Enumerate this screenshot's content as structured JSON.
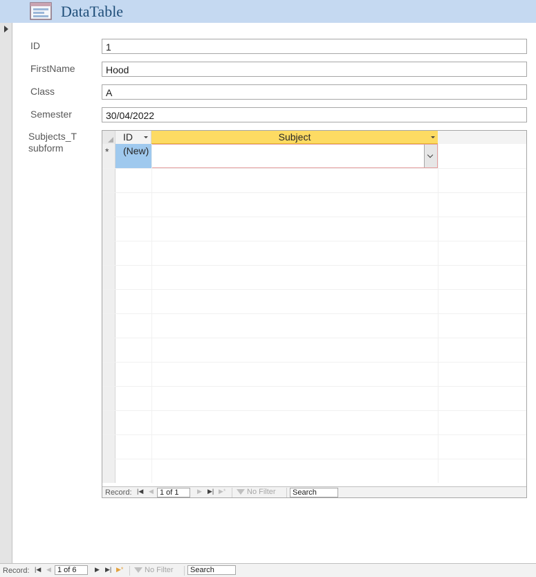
{
  "header": {
    "title": "DataTable"
  },
  "form": {
    "fields": [
      {
        "label": "ID",
        "value": "1"
      },
      {
        "label": "FirstName",
        "value": "Hood"
      },
      {
        "label": "Class",
        "value": "A"
      },
      {
        "label": "Semester",
        "value": "30/04/2022"
      }
    ],
    "subform_label_line1": "Subjects_T",
    "subform_label_line2": "subform"
  },
  "subform": {
    "columns": [
      "ID",
      "Subject"
    ],
    "new_row_marker": "*",
    "new_row_id": "(New)",
    "new_row_subject": "",
    "nav": {
      "record_label": "Record:",
      "record_position": "1 of 1",
      "filter_label": "No Filter",
      "search_label": "Search"
    }
  },
  "main_nav": {
    "record_label": "Record:",
    "record_position": "1 of 6",
    "filter_label": "No Filter",
    "search_label": "Search"
  },
  "colors": {
    "header_bg": "#c5d9f1",
    "active_column": "#fddb63",
    "new_row_id_bg": "#9fc9ee"
  }
}
